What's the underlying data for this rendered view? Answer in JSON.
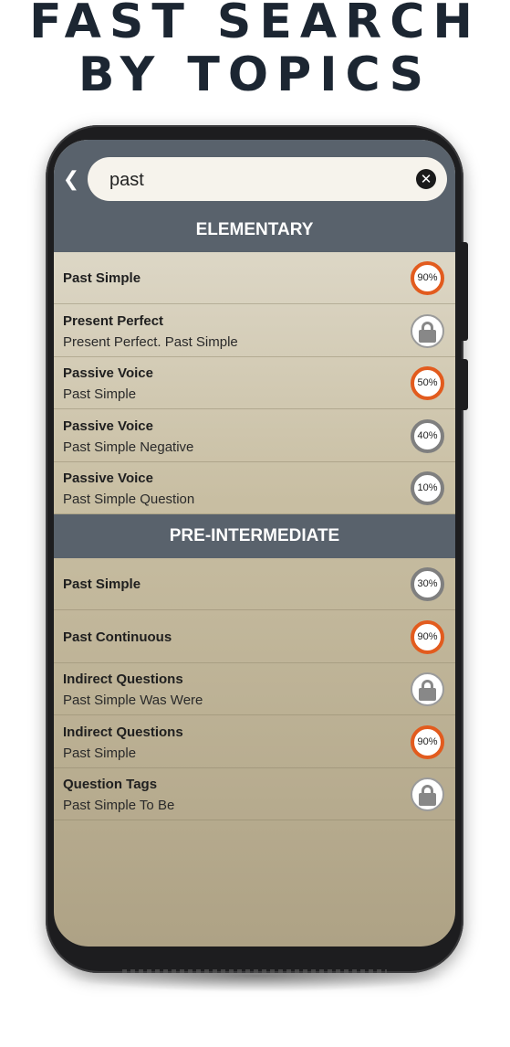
{
  "headline": {
    "line1": "FAST SEARCH",
    "line2": "BY TOPICS"
  },
  "search": {
    "value": "past",
    "back_icon": "chevron-left-icon",
    "clear_icon": "close-circle-icon"
  },
  "sections": [
    {
      "title": "ELEMENTARY",
      "items": [
        {
          "title": "Past Simple",
          "subtitle": "",
          "status": "progress",
          "progress": "90%"
        },
        {
          "title": "Present Perfect",
          "subtitle": "Present Perfect. Past Simple",
          "status": "locked",
          "progress": ""
        },
        {
          "title": "Passive Voice",
          "subtitle": "Past Simple",
          "status": "progress",
          "progress": "50%"
        },
        {
          "title": "Passive Voice",
          "subtitle": "Past Simple Negative",
          "status": "progress",
          "progress": "40%"
        },
        {
          "title": "Passive Voice",
          "subtitle": "Past Simple Question",
          "status": "progress",
          "progress": "10%"
        }
      ]
    },
    {
      "title": "PRE-INTERMEDIATE",
      "items": [
        {
          "title": "Past Simple",
          "subtitle": "",
          "status": "progress",
          "progress": "30%"
        },
        {
          "title": "Past Continuous",
          "subtitle": "",
          "status": "progress",
          "progress": "90%"
        },
        {
          "title": "Indirect Questions",
          "subtitle": "Past Simple Was Were",
          "status": "locked",
          "progress": ""
        },
        {
          "title": "Indirect Questions",
          "subtitle": "Past Simple",
          "status": "progress",
          "progress": "90%"
        },
        {
          "title": "Question Tags",
          "subtitle": "Past Simple To Be",
          "status": "locked",
          "progress": ""
        }
      ]
    }
  ],
  "colors": {
    "accent": "#e25b1e",
    "header": "#59626c",
    "headline": "#1c2632"
  }
}
